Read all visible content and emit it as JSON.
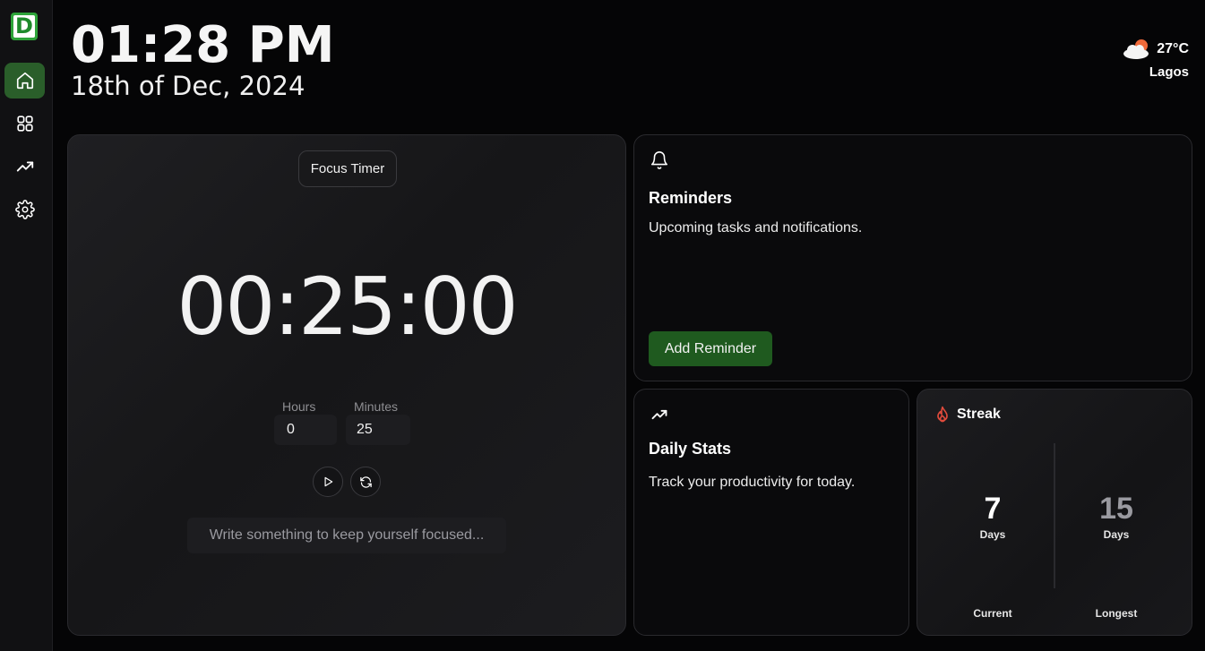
{
  "app": {
    "logo_letter": "D"
  },
  "header": {
    "time": "01:28 PM",
    "date": "18th of Dec, 2024",
    "weather": {
      "temp": "27°C",
      "city": "Lagos",
      "icon": "partly-cloudy-icon"
    }
  },
  "sidebar": {
    "items": [
      {
        "name": "home",
        "icon": "home-icon",
        "active": true
      },
      {
        "name": "apps",
        "icon": "grid-icon",
        "active": false
      },
      {
        "name": "stats",
        "icon": "trending-up-icon",
        "active": false
      },
      {
        "name": "settings",
        "icon": "gear-icon",
        "active": false
      }
    ]
  },
  "timer": {
    "chip_label": "Focus Timer",
    "display": "00:25:00",
    "hours_label": "Hours",
    "minutes_label": "Minutes",
    "hours_value": "0",
    "minutes_value": "25",
    "focus_placeholder": "Write something to keep yourself focused..."
  },
  "reminders": {
    "title": "Reminders",
    "subtitle": "Upcoming tasks and notifications.",
    "button": "Add Reminder"
  },
  "daily_stats": {
    "title": "Daily Stats",
    "subtitle": "Track your productivity for today."
  },
  "streak": {
    "title": "Streak",
    "current_value": "7",
    "current_unit": "Days",
    "current_label": "Current",
    "longest_value": "15",
    "longest_unit": "Days",
    "longest_label": "Longest"
  },
  "colors": {
    "accent_green": "#2a5e2a",
    "button_green": "#1f5a1f",
    "streak_red": "#e04b3c",
    "sun_orange": "#f06a3a"
  }
}
